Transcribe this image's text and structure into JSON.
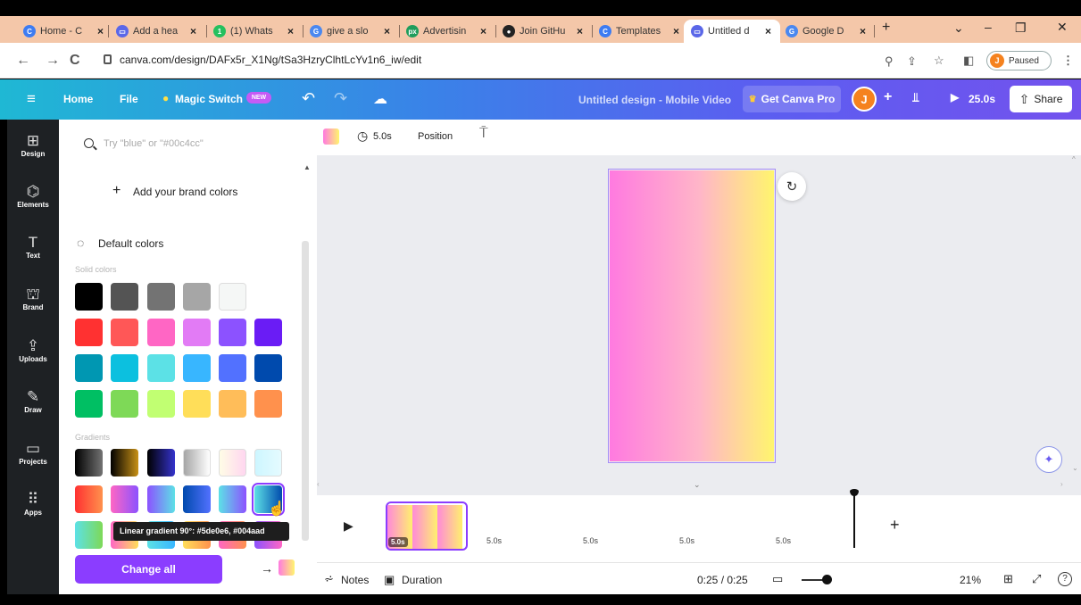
{
  "browser": {
    "tabs": [
      {
        "title": "Home - C",
        "color": "#3d7cf2",
        "glyph": "C"
      },
      {
        "title": "Add a hea",
        "color": "#5a67e8",
        "glyph": "▭"
      },
      {
        "title": "(1) Whats",
        "color": "#25c05e",
        "glyph": "1"
      },
      {
        "title": "give a slo",
        "color": "#4a88f0",
        "glyph": "G"
      },
      {
        "title": "Advertisin",
        "color": "#1e9d5c",
        "glyph": "px"
      },
      {
        "title": "Join GitHu",
        "color": "#222222",
        "glyph": "●"
      },
      {
        "title": "Templates",
        "color": "#3d7cf2",
        "glyph": "C"
      },
      {
        "title": "Untitled d",
        "color": "#5a67e8",
        "glyph": "▭"
      },
      {
        "title": "Google D",
        "color": "#4a88f0",
        "glyph": "G"
      }
    ],
    "new_tab": "+",
    "url": "canva.com/design/DAFx5r_X1Ng/tSa3HzryClhtLcYv1n6_iw/edit",
    "paused_label": "Paused",
    "profile_initial": "J"
  },
  "header": {
    "home": "Home",
    "file": "File",
    "magic_switch": "Magic Switch",
    "new_badge": "NEW",
    "design_title": "Untitled design - Mobile Video",
    "get_pro": "Get Canva Pro",
    "avatar": "J",
    "play_duration": "25.0s",
    "share": "Share"
  },
  "rail": [
    {
      "label": "Design",
      "icon": "layout-icon",
      "glyph": "⊞"
    },
    {
      "label": "Elements",
      "icon": "shapes-icon",
      "glyph": "⌬"
    },
    {
      "label": "Text",
      "icon": "text-icon",
      "glyph": "T"
    },
    {
      "label": "Brand",
      "icon": "brand-icon",
      "glyph": "⛫"
    },
    {
      "label": "Uploads",
      "icon": "upload-icon",
      "glyph": "⇪"
    },
    {
      "label": "Draw",
      "icon": "draw-icon",
      "glyph": "✎"
    },
    {
      "label": "Projects",
      "icon": "folder-icon",
      "glyph": "▭"
    },
    {
      "label": "Apps",
      "icon": "apps-icon",
      "glyph": "⠿"
    }
  ],
  "panel": {
    "search_placeholder": "Try \"blue\" or \"#00c4cc\"",
    "add_brand": "Add your brand colors",
    "default_colors": "Default colors",
    "solid_label": "Solid colors",
    "gradients_label": "Gradients",
    "tooltip": "Linear gradient 90°: #5de0e6, #004aad",
    "change_all": "Change all",
    "solid_colors": [
      [
        "#000000",
        "#545454",
        "#737373",
        "#a6a6a6",
        "#f5f7f6"
      ],
      [
        "#ff3131",
        "#ff5757",
        "#ff66c4",
        "#e27bf5",
        "#8c52ff",
        "#6a1cf5"
      ],
      [
        "#0097b2",
        "#0cc0df",
        "#5ce1e6",
        "#38b6ff",
        "#5271ff",
        "#004aad"
      ],
      [
        "#00bf63",
        "#7ed957",
        "#c1ff72",
        "#ffde59",
        "#ffbd59",
        "#ff914d"
      ]
    ],
    "gradient_rows": [
      [
        "linear-gradient(90deg,#000000,#737373)",
        "linear-gradient(90deg,#000000,#c89116)",
        "linear-gradient(90deg,#000000,#3533cd)",
        "linear-gradient(90deg,#a6a6a6,#ffffff)",
        "linear-gradient(90deg,#fffde6,#ffd6f0)",
        "linear-gradient(90deg,#cdf6ff,#e5fbff)"
      ],
      [
        "linear-gradient(90deg,#ff3131,#ff914d)",
        "linear-gradient(90deg,#ff66c4,#8c52ff)",
        "linear-gradient(90deg,#8c52ff,#5ce1e6)",
        "linear-gradient(90deg,#004aad,#5271ff)",
        "linear-gradient(90deg,#5ce1e6,#8c52ff)",
        "linear-gradient(90deg,#5de0e6,#004aad)"
      ],
      [
        "linear-gradient(90deg,#5ce1e6,#7ed957)",
        "linear-gradient(90deg,#ff66c4,#ffde59)",
        "linear-gradient(90deg,#5ce1e6,#38b6ff)",
        "linear-gradient(90deg,#ffde59,#ff914d)",
        "linear-gradient(90deg,#ff66c4,#ff914d)",
        "linear-gradient(90deg,#8c52ff,#ff66c4)"
      ]
    ]
  },
  "toolbar": {
    "duration": "5.0s",
    "position": "Position"
  },
  "timeline": {
    "clip_duration": "5.0s",
    "ticks": [
      "5.0s",
      "5.0s",
      "5.0s",
      "5.0s"
    ],
    "add": "+"
  },
  "footer": {
    "notes": "Notes",
    "duration": "Duration",
    "time": "0:25 / 0:25",
    "zoom": "21%"
  },
  "colors": {
    "accent": "#8b3dff",
    "canvas_from": "#ff7ae0",
    "canvas_to": "#fff56e"
  }
}
